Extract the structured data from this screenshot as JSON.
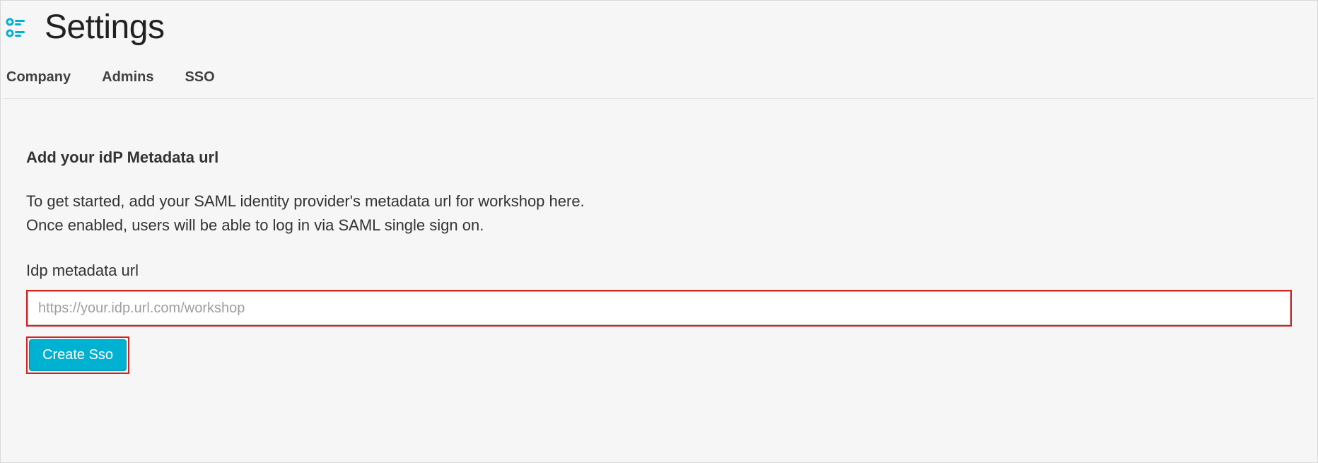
{
  "header": {
    "title": "Settings"
  },
  "tabs": [
    {
      "label": "Company"
    },
    {
      "label": "Admins"
    },
    {
      "label": "SSO"
    }
  ],
  "sso": {
    "heading": "Add your idP Metadata url",
    "description_line1": "To get started, add your SAML identity provider's metadata url for workshop here.",
    "description_line2": "Once enabled, users will be able to log in via SAML single sign on.",
    "field_label": "Idp metadata url",
    "placeholder": "https://your.idp.url.com/workshop",
    "value": "",
    "submit_label": "Create Sso"
  },
  "colors": {
    "accent": "#00b1d2",
    "highlight": "#d22323"
  }
}
